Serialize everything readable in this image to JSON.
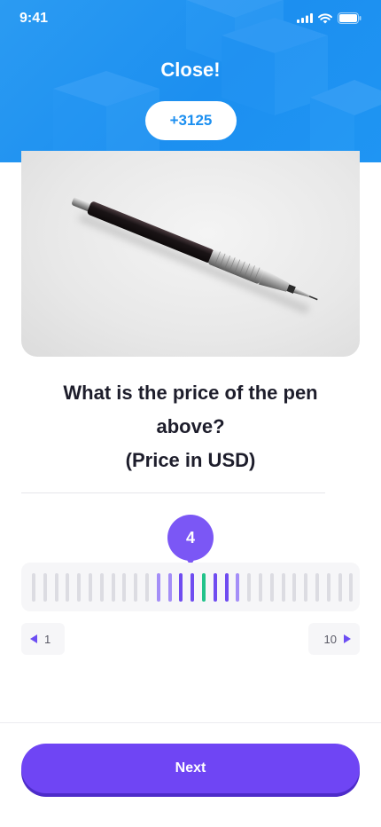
{
  "status_bar": {
    "time": "9:41"
  },
  "header": {
    "title": "Close!",
    "score": "+3125"
  },
  "question": {
    "line1": "What is the price of the pen",
    "line2": "above?",
    "line3": "(Price in USD)"
  },
  "slider": {
    "value": "4",
    "min_label": "1",
    "max_label": "10",
    "tick_count": 29,
    "selected_tick_index": 15,
    "active_range": [
      11,
      18
    ]
  },
  "actions": {
    "next_label": "Next"
  },
  "colors": {
    "header": "#1c8ff0",
    "accent": "#6f45f4",
    "current_tick": "#21c28a"
  }
}
